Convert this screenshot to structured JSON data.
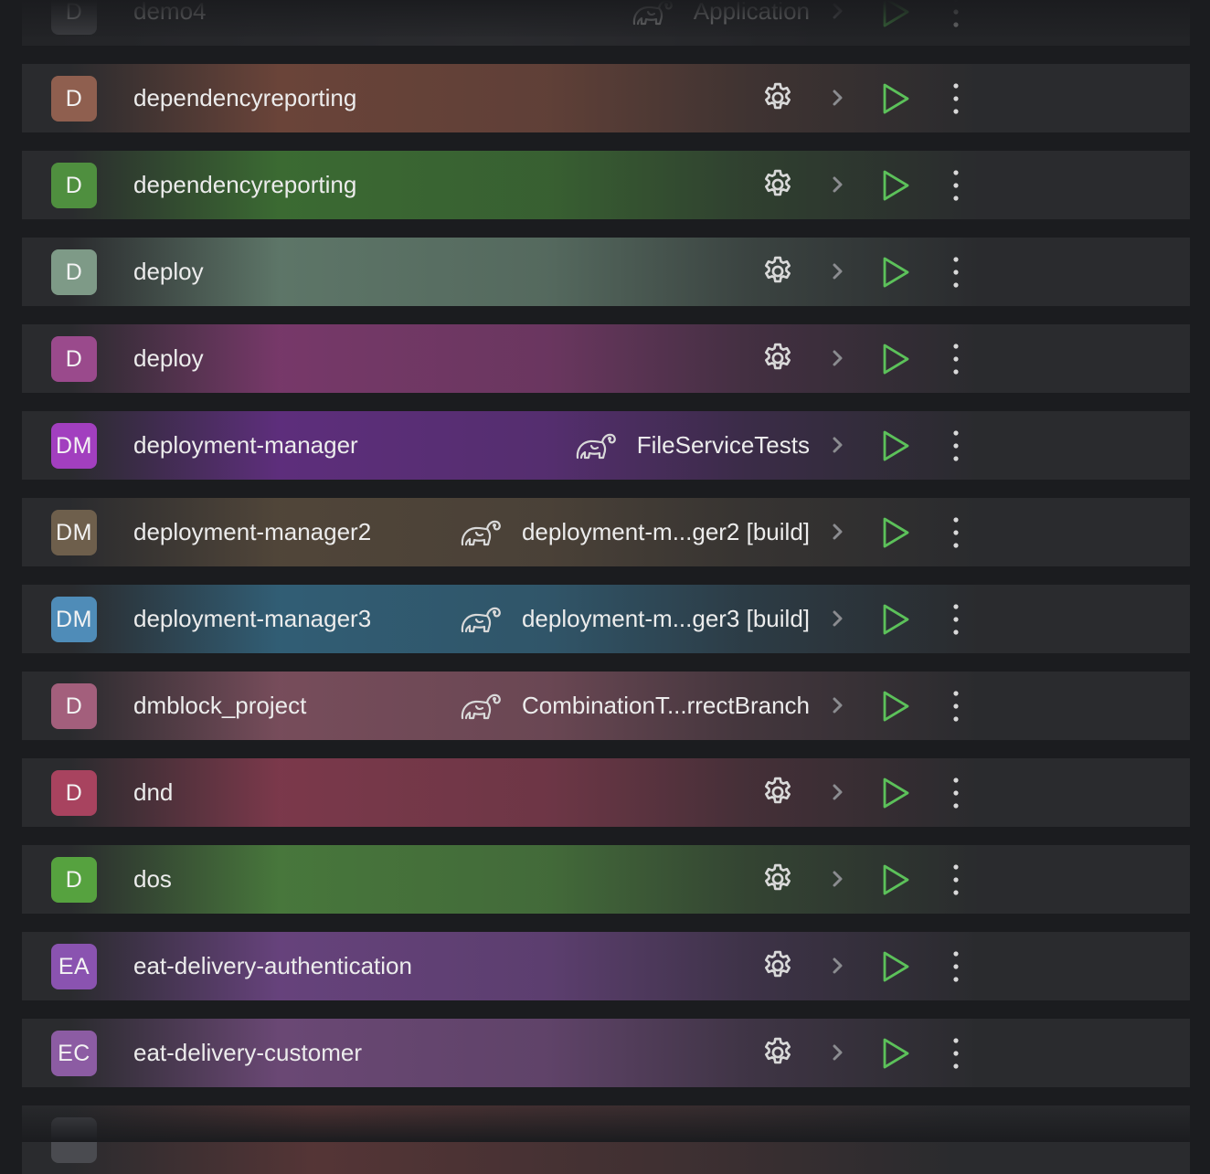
{
  "accent": {
    "play": "#5cc15a",
    "icon": "#d9d9d9",
    "chevron": "#8b8c90"
  },
  "partial_top": {
    "initials": "D",
    "name": "demo4",
    "config": "Application",
    "color": "#5d5e63"
  },
  "rows": [
    {
      "initials": "D",
      "name": "dependencyreporting",
      "config_icon": "gear-icon",
      "config": "",
      "color": "#8f5f4f",
      "glow": "#7a4a3c"
    },
    {
      "initials": "D",
      "name": "dependencyreporting",
      "config_icon": "gear-icon",
      "config": "",
      "color": "#4f8f3f",
      "glow": "#3f7a33"
    },
    {
      "initials": "D",
      "name": "deploy",
      "config_icon": "gear-icon",
      "config": "",
      "color": "#7e9a87",
      "glow": "#6a8876"
    },
    {
      "initials": "D",
      "name": "deploy",
      "config_icon": "gear-icon",
      "config": "",
      "color": "#9a4a8c",
      "glow": "#8a3c78"
    },
    {
      "initials": "DM",
      "name": "deployment-manager",
      "config_icon": "gradle-elephant-icon",
      "config": "FileServiceTests",
      "color": "#a23fbf",
      "glow": "#6a2f8f"
    },
    {
      "initials": "DM",
      "name": "deployment-manager2",
      "config_icon": "gradle-elephant-icon",
      "config": "deployment-m...ger2 [build]",
      "color": "#6e5f4c",
      "glow": "#5a4c3c"
    },
    {
      "initials": "DM",
      "name": "deployment-manager3",
      "config_icon": "gradle-elephant-icon",
      "config": "deployment-m...ger3 [build]",
      "color": "#4f8cb8",
      "glow": "#336a86"
    },
    {
      "initials": "D",
      "name": "dmblock_project",
      "config_icon": "gradle-elephant-icon",
      "config": "CombinationT...rrectBranch",
      "color": "#a35f7c",
      "glow": "#8a5566"
    },
    {
      "initials": "D",
      "name": "dnd",
      "config_icon": "gear-icon",
      "config": "",
      "color": "#a8435f",
      "glow": "#8f3c52"
    },
    {
      "initials": "D",
      "name": "dos",
      "config_icon": "gear-icon",
      "config": "",
      "color": "#56a23f",
      "glow": "#4f8a3f"
    },
    {
      "initials": "EA",
      "name": "eat-delivery-authentication",
      "config_icon": "gear-icon",
      "config": "",
      "color": "#8a53b0",
      "glow": "#75488f"
    },
    {
      "initials": "EC",
      "name": "eat-delivery-customer",
      "config_icon": "gear-icon",
      "config": "",
      "color": "#8c5ca3",
      "glow": "#7a4f86"
    }
  ],
  "partial_bottom": {
    "initials": "",
    "name": "",
    "color": "#6a3a3a"
  }
}
